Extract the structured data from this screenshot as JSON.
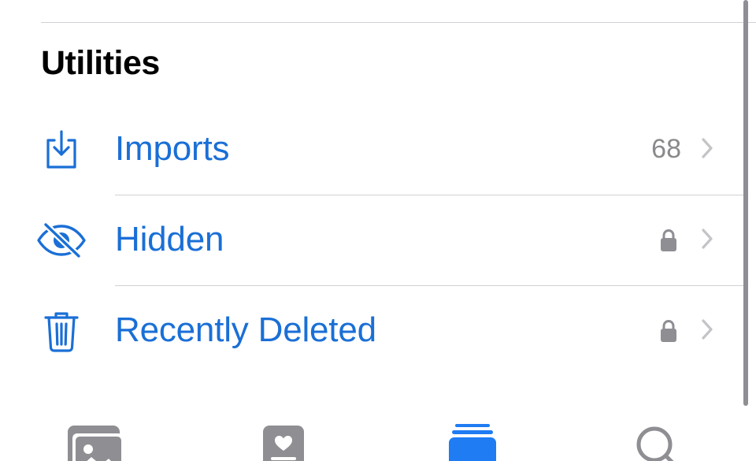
{
  "section": {
    "title": "Utilities"
  },
  "rows": [
    {
      "label": "Imports",
      "count": "68",
      "icon": "import-tray-icon"
    },
    {
      "label": "Hidden",
      "icon": "eye-slash-icon",
      "locked": true
    },
    {
      "label": "Recently Deleted",
      "icon": "trash-icon",
      "locked": true
    }
  ],
  "tabbar": {
    "tabs": [
      {
        "icon": "library-photos-icon",
        "active": false
      },
      {
        "icon": "for-you-icon",
        "active": false
      },
      {
        "icon": "albums-icon",
        "active": true
      },
      {
        "icon": "search-icon",
        "active": false
      }
    ]
  },
  "colors": {
    "accent": "#1a6fd6",
    "active_tab": "#1f7cf2",
    "inactive_tab": "#8e8e93",
    "secondary_text": "#8a8a8e",
    "divider": "#d1d1d6"
  }
}
